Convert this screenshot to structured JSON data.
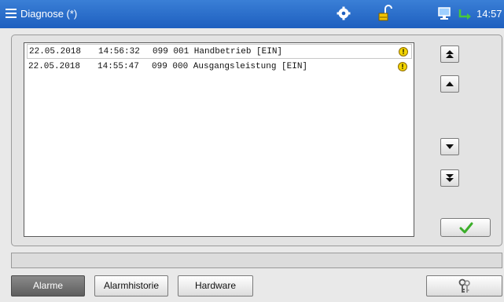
{
  "titlebar": {
    "title": "Diagnose (*)",
    "clock": "14:57",
    "icons": [
      "menu-icon",
      "gear-icon",
      "lock-open-icon",
      "monitor-icon",
      "enter-arrow-icon"
    ]
  },
  "alarms": [
    {
      "date": "22.05.2018",
      "time": "14:56:32",
      "message": "099 001 Handbetrieb [EIN]",
      "icon": "warning-icon"
    },
    {
      "date": "22.05.2018",
      "time": "14:55:47",
      "message": "099 000 Ausgangsleistung [EIN]",
      "icon": "warning-icon"
    }
  ],
  "side_buttons": [
    "scroll-top-icon",
    "scroll-up-icon",
    "scroll-down-icon",
    "scroll-bottom-icon",
    "checkmark-icon"
  ],
  "tabs": [
    {
      "label": "Alarme",
      "active": true
    },
    {
      "label": "Alarmhistorie",
      "active": false
    },
    {
      "label": "Hardware",
      "active": false
    }
  ],
  "colors": {
    "titlebar": "#1e5fbf",
    "warning": "#f2d400",
    "check": "#3cae2a",
    "enter_arrow": "#46c83c"
  }
}
